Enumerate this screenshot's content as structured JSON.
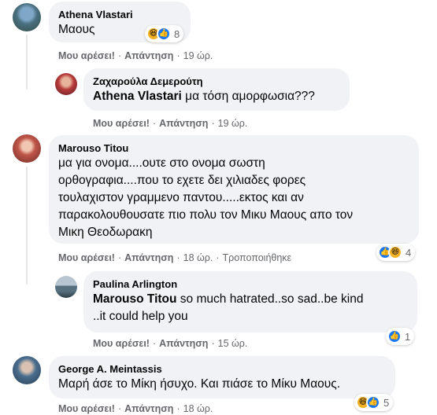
{
  "colors": {
    "bubble_bg": "#f0f2f5",
    "meta_text": "#65676b",
    "like_blue": "#1877f2",
    "haha_yellow": "#f7b125"
  },
  "comments": [
    {
      "author": "Athena Vlastari",
      "text": "Μαους",
      "like_label": "Μου αρέσει!",
      "reply_label": "Απάντηση",
      "time": "19 ώρ.",
      "edited": "",
      "reactions": [
        "haha-icon",
        "like-icon"
      ],
      "reaction_count": "8"
    },
    {
      "author": "Ζαχαρούλα Δεμερούτη",
      "mention": "Athena Vlastari",
      "text": " μα τόση αμορφωσια???",
      "like_label": "Μου αρέσει!",
      "reply_label": "Απάντηση",
      "time": "19 ώρ."
    },
    {
      "author": "Marouso Titou",
      "text": "μα για ονομα....ουτε στο ονομα σωστη\nορθογραφια....που το εχετε δει χιλιαδες φορες\nτουλαχιστον γραμμενο παντου.....εκτος και αν\nπαρακολουθουσατε πιο πολυ τον Μικυ Μαους απο τον\nΜικη Θεοδωρακη",
      "like_label": "Μου αρέσει!",
      "reply_label": "Απάντηση",
      "time": "18 ώρ.",
      "edited": "Τροποποιήθηκε",
      "reactions": [
        "like-icon",
        "haha-icon"
      ],
      "reaction_count": "4"
    },
    {
      "author": "Paulina Arlington",
      "mention": "Marouso Titou",
      "text": " so much hatrated..so sad..be kind\n..it could help you",
      "like_label": "Μου αρέσει!",
      "reply_label": "Απάντηση",
      "time": "15 ώρ.",
      "reactions": [
        "like-icon"
      ],
      "reaction_count": "1"
    },
    {
      "author": "George A. Meintassis",
      "text": "Μαρή άσε το Μίκη ήσυχο. Και πιάσε το Μίκυ Μαους.",
      "like_label": "Μου αρέσει!",
      "reply_label": "Απάντηση",
      "time": "18 ώρ.",
      "reactions": [
        "haha-icon",
        "like-icon"
      ],
      "reaction_count": "5"
    }
  ],
  "separator": "·"
}
